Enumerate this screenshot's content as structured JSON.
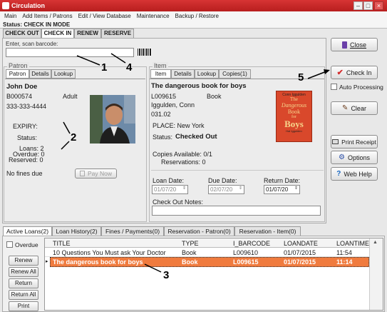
{
  "window": {
    "title": "Circulation"
  },
  "menu": [
    "Main",
    "Add Items / Patrons",
    "Edit / View Database",
    "Maintenance",
    "Backup / Restore"
  ],
  "status_line": "Status: CHECK IN MODE",
  "mode_tabs": [
    "CHECK OUT",
    "CHECK IN",
    "RENEW",
    "RESERVE"
  ],
  "barcode": {
    "label": "Enter, scan barcode:",
    "value": ""
  },
  "patron": {
    "group_label": "Patron",
    "tabs": [
      "Patron",
      "Details",
      "Lookup"
    ],
    "name": "John Doe",
    "id": "B000574",
    "type": "Adult",
    "phone": "333-333-4444",
    "expiry_label": "EXPIRY:",
    "status_label": "Status:",
    "loans": "Loans: 2",
    "overdue": "Overdue: 0",
    "reserved": "Reserved: 0",
    "fines": "No fines due",
    "pay_now": "Pay Now"
  },
  "item": {
    "group_label": "Item",
    "tabs": [
      "Item",
      "Details",
      "Lookup",
      "Copies(1)"
    ],
    "title": "The dangerous book for boys",
    "barcode": "L009615",
    "type": "Book",
    "author": "Iggulden, Conn",
    "call_no": "031.02",
    "place": "PLACE:  New York",
    "status_label": "Status:",
    "status_value": "Checked Out",
    "copies_available": "Copies Available: 0/1",
    "reservations": "Reservations: 0",
    "loan_date_label": "Loan Date:",
    "loan_date": "01/07/20",
    "due_date_label": "Due Date:",
    "due_date": "02/07/20",
    "return_date_label": "Return Date:",
    "return_date": "01/07/20",
    "notes_label": "Check Out Notes:",
    "cover": {
      "author": "Conn Iggulden",
      "line1": "The",
      "line2": "Dangerous",
      "line3": "Book",
      "line4": "for",
      "line5": "Boys",
      "footer": "Hal Iggulden"
    }
  },
  "buttons": {
    "close": "Close",
    "check_in": "Check In",
    "auto_processing": "Auto Processing",
    "clear": "Clear",
    "print_receipt": "Print Receipt",
    "options": "Options",
    "web_help": "Web Help"
  },
  "bottom_tabs": [
    "Active Loans(2)",
    "Loan History(2)",
    "Fines / Payments(0)",
    "Reservation - Patron(0)",
    "Reservation - Item(0)"
  ],
  "overdue_checkbox": "Overdue",
  "side_buttons": [
    "Renew",
    "Renew All",
    "Return",
    "Return All",
    "Print"
  ],
  "loans_table": {
    "columns": [
      "TITLE",
      "TYPE",
      "I_BARCODE",
      "LOANDATE",
      "LOANTIME"
    ],
    "rows": [
      [
        "10 Questions You Must ask Your Doctor",
        "Book",
        "L009610",
        "01/07/2015",
        "11:54"
      ],
      [
        "The dangerous book for boys",
        "Book",
        "L009615",
        "01/07/2015",
        "11:14"
      ]
    ]
  },
  "markers": [
    "1",
    "2",
    "3",
    "4",
    "5"
  ],
  "colors": {
    "titlebar": "#c62828",
    "selected_row": "#f07b3e",
    "status_red": "#c00000",
    "check_icon": "#d32f2f"
  }
}
